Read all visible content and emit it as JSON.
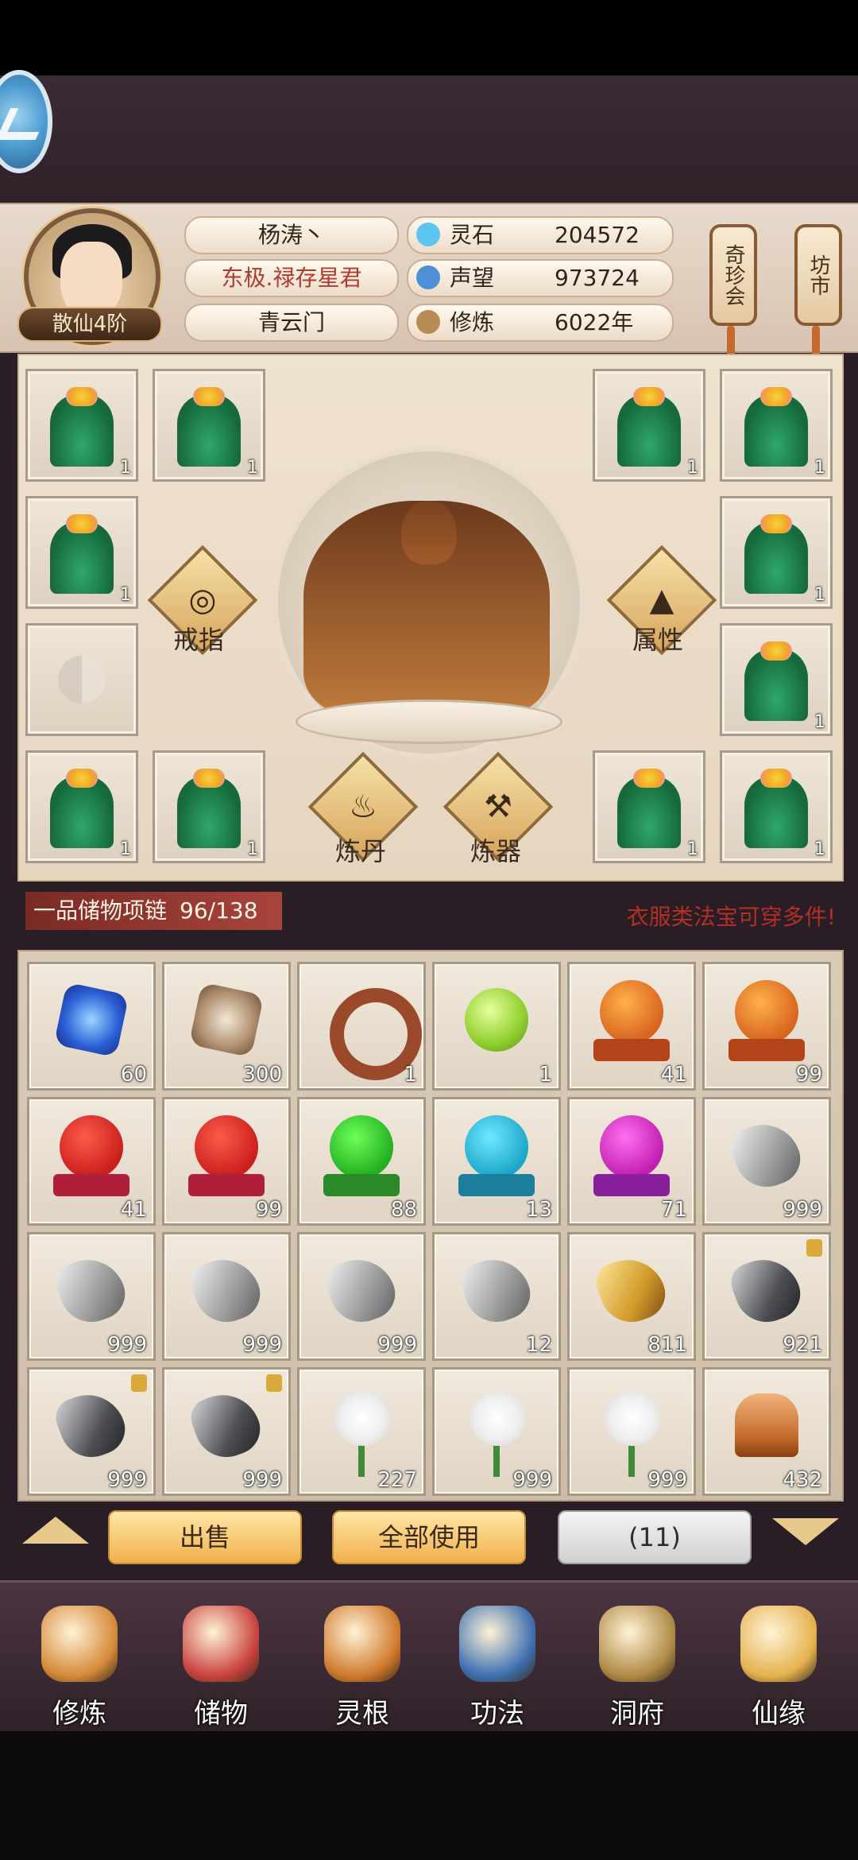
{
  "player": {
    "name": "杨涛丶",
    "title": "东极.禄存星君",
    "sect": "青云门",
    "rank": "散仙4阶"
  },
  "stats": [
    {
      "label": "灵石",
      "value": "204572",
      "icon": "spirit-stone-icon",
      "color": "#5cc6f0"
    },
    {
      "label": "声望",
      "value": "973724",
      "icon": "reputation-icon",
      "color": "#4f8fd6"
    },
    {
      "label": "修炼",
      "value": "6022年",
      "icon": "cultivation-icon",
      "color": "#b88b54"
    }
  ],
  "side_buttons": {
    "treasure_fair": "奇珍会",
    "market": "坊市"
  },
  "equipment_slots": {
    "counts": [
      "1",
      "1",
      "1",
      "1",
      "1",
      "1",
      "",
      "1",
      "1",
      "1",
      "1",
      "1"
    ]
  },
  "actions": {
    "ring": "戒指",
    "attributes": "属性",
    "alchemy": "炼丹",
    "forge": "炼器"
  },
  "storage": {
    "tag": "一品储物项链",
    "capacity": "96/138",
    "hint": "衣服类法宝可穿多件!"
  },
  "items": [
    {
      "count": "60",
      "type": "blue-gem"
    },
    {
      "count": "300",
      "type": "brown-gem"
    },
    {
      "count": "1",
      "type": "ring"
    },
    {
      "count": "1",
      "type": "green-orb"
    },
    {
      "count": "41",
      "type": "orange-orb-stand"
    },
    {
      "count": "99",
      "type": "orange-orb-stand"
    },
    {
      "count": "41",
      "type": "red-orb-stand"
    },
    {
      "count": "99",
      "type": "red-orb-stand"
    },
    {
      "count": "88",
      "type": "green-orb-stand"
    },
    {
      "count": "13",
      "type": "cyan-orb-stand"
    },
    {
      "count": "71",
      "type": "magenta-orb-stand"
    },
    {
      "count": "999",
      "type": "iron-ore"
    },
    {
      "count": "999",
      "type": "iron-ore"
    },
    {
      "count": "999",
      "type": "iron-ore"
    },
    {
      "count": "999",
      "type": "iron-ore"
    },
    {
      "count": "12",
      "type": "iron-ore"
    },
    {
      "count": "811",
      "type": "gold-ore"
    },
    {
      "count": "921",
      "type": "dark-ore"
    },
    {
      "count": "999",
      "type": "dark-ore"
    },
    {
      "count": "999",
      "type": "dark-ore"
    },
    {
      "count": "227",
      "type": "white-flower"
    },
    {
      "count": "999",
      "type": "white-flower"
    },
    {
      "count": "999",
      "type": "white-flower"
    },
    {
      "count": "432",
      "type": "ginseng"
    }
  ],
  "buttons": {
    "sell": "出售",
    "use_all": "全部使用",
    "selected": "(11)"
  },
  "nav": [
    {
      "label": "修炼",
      "icon": "monk-icon",
      "color": "#d68a3a"
    },
    {
      "label": "储物",
      "icon": "pouch-icon",
      "color": "#c9433f"
    },
    {
      "label": "灵根",
      "icon": "spirit-root-icon",
      "color": "#d07a2d"
    },
    {
      "label": "功法",
      "icon": "scroll-book-icon",
      "color": "#3e6fb0"
    },
    {
      "label": "洞府",
      "icon": "cave-palace-icon",
      "color": "#b08a46"
    },
    {
      "label": "仙缘",
      "icon": "gourd-icon",
      "color": "#e6b24f"
    }
  ]
}
